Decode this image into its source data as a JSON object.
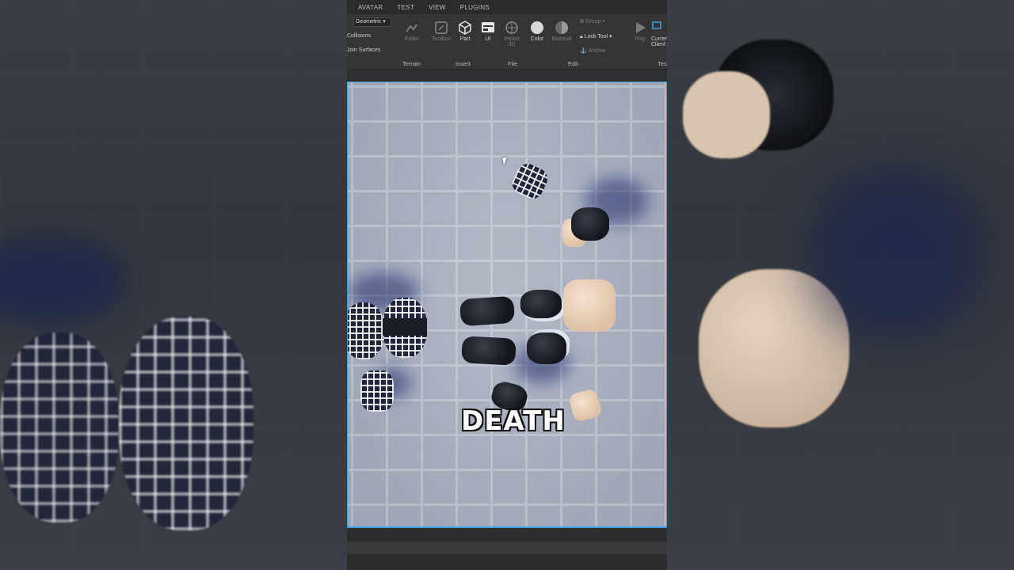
{
  "menu": {
    "items": [
      "AVATAR",
      "TEST",
      "VIEW",
      "PLUGINS"
    ]
  },
  "ribbon": {
    "mode_value": "Geometric",
    "toggles": [
      "Collisions",
      "Join Surfaces"
    ],
    "buttons": {
      "editor": "Editor",
      "toolbox": "Toolbox",
      "part": "Part",
      "ui": "UI",
      "import3d": "Import 3D",
      "color": "Color",
      "material": "Material",
      "group": "Group",
      "lock_tool": "Lock Tool",
      "anchor": "Anchor",
      "play": "Play",
      "current_client": "Current Client"
    },
    "groups": {
      "terrain": "Terrain",
      "insert": "Insert",
      "file": "File",
      "edit": "Edit",
      "test": "Test"
    }
  },
  "caption": "DEATH",
  "colors": {
    "viewport_border": "#39a0e6",
    "ribbon_bg": "#353535"
  }
}
